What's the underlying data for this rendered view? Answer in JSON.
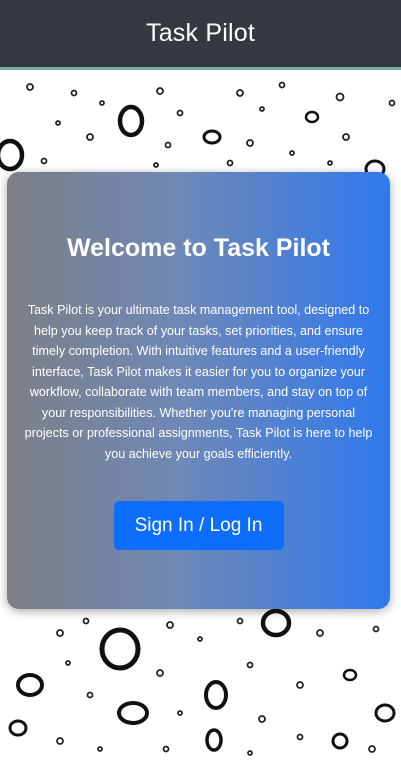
{
  "header": {
    "title": "Task Pilot",
    "background_color": "#343a40"
  },
  "background": {
    "description_icon": "water-drops-pattern"
  },
  "welcome_card": {
    "title": "Welcome to Task Pilot",
    "body": "Task Pilot is your ultimate task management tool, designed to help you keep track of your tasks, set priorities, and ensure timely completion. With intuitive features and a user-friendly interface, Task Pilot makes it easier for you to organize your workflow, collaborate with team members, and stay on top of your responsibilities. Whether you're managing personal projects or professional assignments, Task Pilot is here to help you achieve your goals efficiently.",
    "sign_in_label": "Sign In / Log In",
    "gradient_start": "#7d7f86",
    "gradient_end": "#2f79ee",
    "button_color": "#0d6efd"
  }
}
